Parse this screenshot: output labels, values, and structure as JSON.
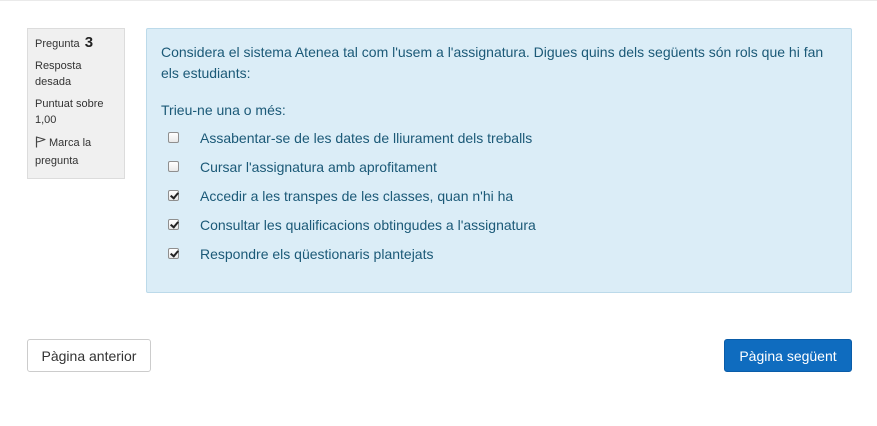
{
  "info": {
    "question_label": "Pregunta",
    "question_number": "3",
    "state_line1": "Resposta",
    "state_line2": "desada",
    "grade_line1": "Puntuat sobre",
    "grade_line2": "1,00",
    "flag_line1": "Marca la",
    "flag_line2": "pregunta",
    "flag_icon": "flag-icon"
  },
  "question": {
    "text_line1": "Considera el sistema Atenea tal com l'usem a l'assignatura. Digues quins dels següents són rols que hi fan",
    "text_line2": "els estudiants:",
    "prompt": "Trieu-ne una o més:",
    "options": [
      {
        "label": "Assabentar-se de les dates de lliurament dels treballs",
        "checked": false
      },
      {
        "label": "Cursar l'assignatura amb aprofitament",
        "checked": false
      },
      {
        "label": "Accedir a les transpes de les classes, quan n'hi ha",
        "checked": true
      },
      {
        "label": "Consultar les qualificacions obtingudes a l'assignatura",
        "checked": true
      },
      {
        "label": "Respondre els qüestionaris plantejats",
        "checked": true
      }
    ]
  },
  "nav": {
    "prev_label": "Pàgina anterior",
    "next_label": "Pàgina següent"
  },
  "colors": {
    "question_bg": "#dbedf7",
    "question_text": "#1b5977",
    "primary_button": "#0f6cbf"
  }
}
